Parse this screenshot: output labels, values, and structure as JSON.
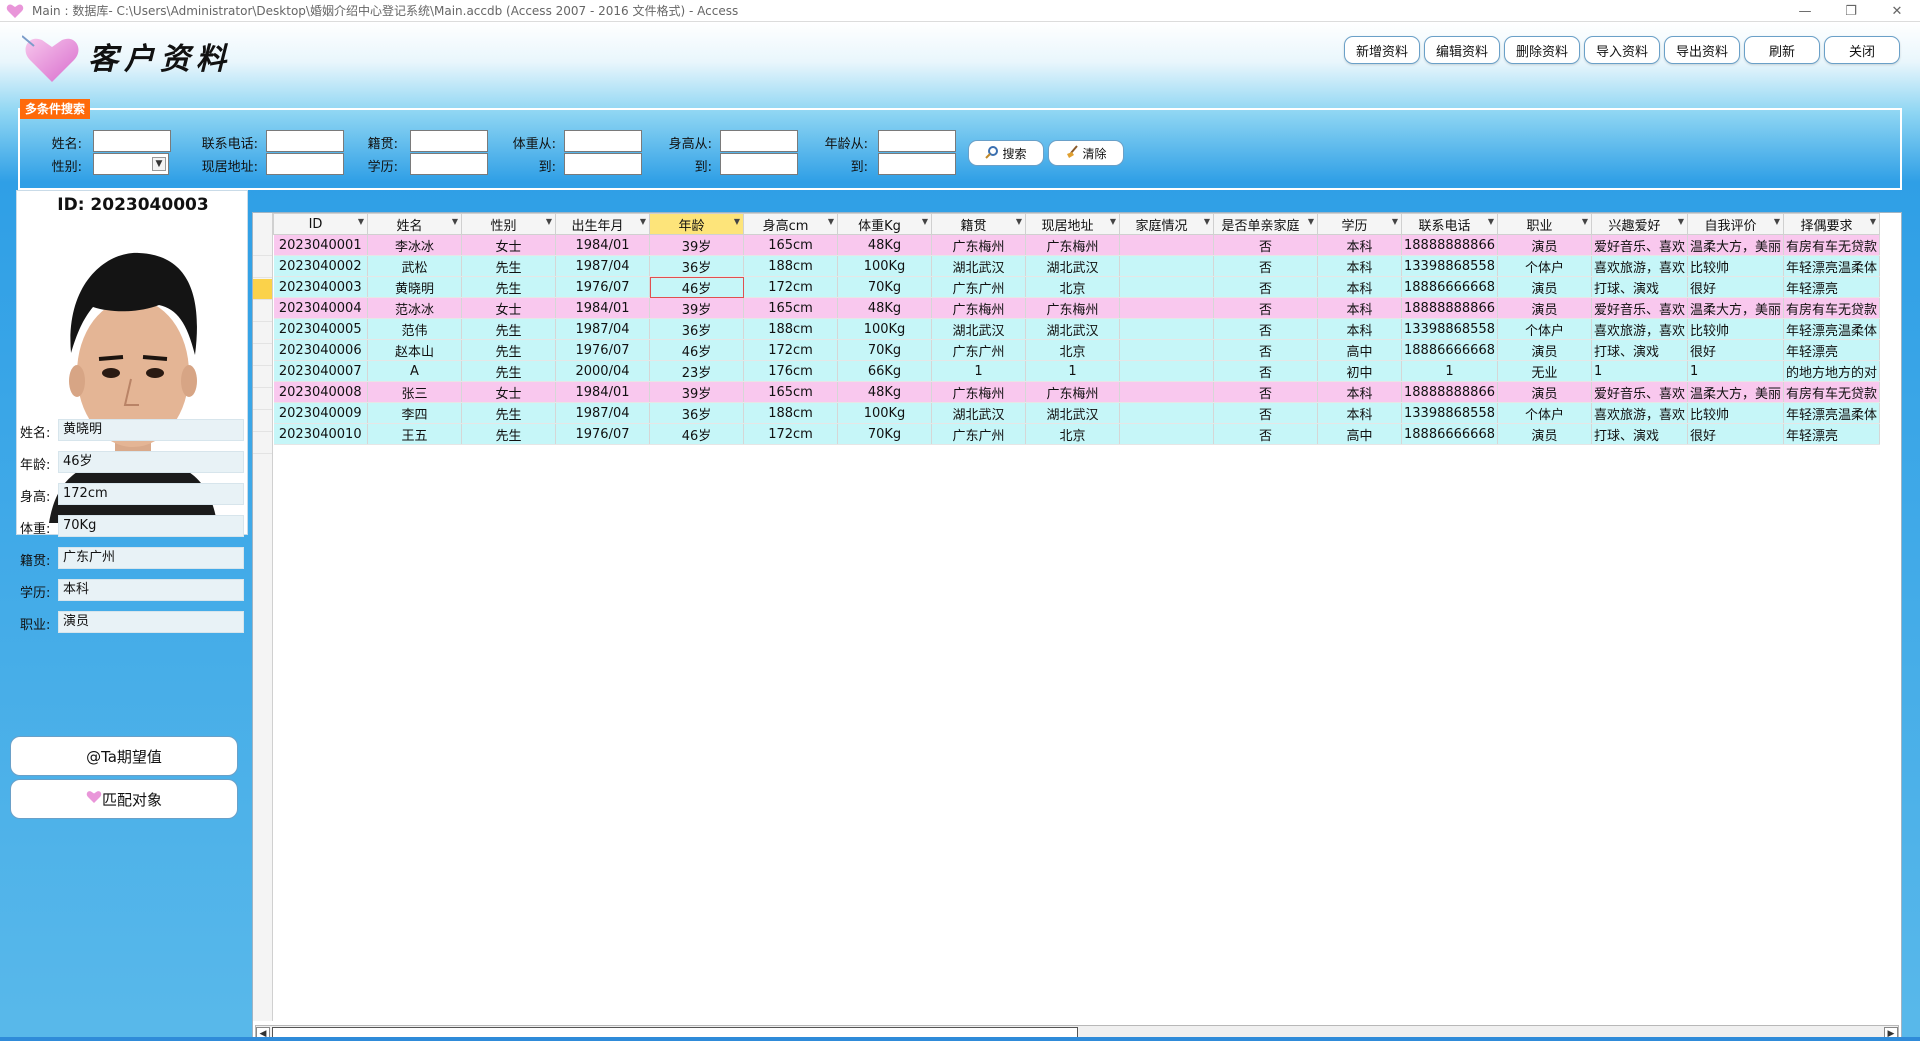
{
  "window": {
    "title": "Main : 数据库- C:\\Users\\Administrator\\Desktop\\婚姻介绍中心登记系统\\Main.accdb (Access 2007 - 2016 文件格式) - Access",
    "minimize": "—",
    "restore": "❐",
    "close": "✕"
  },
  "header": {
    "title": "客户资料"
  },
  "toolbar": {
    "add": "新增资料",
    "edit": "编辑资料",
    "delete": "删除资料",
    "import": "导入资料",
    "export": "导出资料",
    "refresh": "刷新",
    "close": "关闭"
  },
  "search": {
    "tag": "多条件搜索",
    "name_label": "姓名:",
    "gender_label": "性别:",
    "phone_label": "联系电话:",
    "address_label": "现居地址:",
    "native_label": "籍贯:",
    "education_label": "学历:",
    "weight_from_label": "体重从:",
    "weight_to_label": "到:",
    "height_from_label": "身高从:",
    "height_to_label": "到:",
    "age_from_label": "年龄从:",
    "age_to_label": "到:",
    "search_button": "搜索",
    "clear_button": "清除"
  },
  "detail": {
    "id_label": "ID:  2023040003",
    "fields": [
      {
        "label": "姓名:",
        "value": "黄晓明"
      },
      {
        "label": "年龄:",
        "value": "46岁"
      },
      {
        "label": "身高:",
        "value": "172cm"
      },
      {
        "label": "体重:",
        "value": "70Kg"
      },
      {
        "label": "籍贯:",
        "value": "广东广州"
      },
      {
        "label": "学历:",
        "value": "本科"
      },
      {
        "label": "职业:",
        "value": "演员"
      }
    ],
    "expect_button": "@Ta期望值",
    "match_button": "匹配对象"
  },
  "table": {
    "columns": [
      "ID",
      "姓名",
      "性别",
      "出生年月",
      "年龄",
      "身高cm",
      "体重Kg",
      "籍贯",
      "现居地址",
      "家庭情况",
      "是否单亲家庭",
      "学历",
      "联系电话",
      "职业",
      "兴趣爱好",
      "自我评价",
      "择偶要求"
    ],
    "rows": [
      [
        "2023040001",
        "李冰冰",
        "女士",
        "1984/01",
        "39岁",
        "165cm",
        "48Kg",
        "广东梅州",
        "广东梅州",
        "",
        "否",
        "本科",
        "18888888866",
        "演员",
        "爱好音乐、喜欢",
        "温柔大方，美丽",
        "有房有车无贷款"
      ],
      [
        "2023040002",
        "武松",
        "先生",
        "1987/04",
        "36岁",
        "188cm",
        "100Kg",
        "湖北武汉",
        "湖北武汉",
        "",
        "否",
        "本科",
        "13398868558",
        "个体户",
        "喜欢旅游，喜欢",
        "比较帅",
        "年轻漂亮温柔体"
      ],
      [
        "2023040003",
        "黄晓明",
        "先生",
        "1976/07",
        "46岁",
        "172cm",
        "70Kg",
        "广东广州",
        "北京",
        "",
        "否",
        "本科",
        "18886666668",
        "演员",
        "打球、演戏",
        "很好",
        "年轻漂亮"
      ],
      [
        "2023040004",
        "范冰冰",
        "女士",
        "1984/01",
        "39岁",
        "165cm",
        "48Kg",
        "广东梅州",
        "广东梅州",
        "",
        "否",
        "本科",
        "18888888866",
        "演员",
        "爱好音乐、喜欢",
        "温柔大方，美丽",
        "有房有车无贷款"
      ],
      [
        "2023040005",
        "范伟",
        "先生",
        "1987/04",
        "36岁",
        "188cm",
        "100Kg",
        "湖北武汉",
        "湖北武汉",
        "",
        "否",
        "本科",
        "13398868558",
        "个体户",
        "喜欢旅游，喜欢",
        "比较帅",
        "年轻漂亮温柔体"
      ],
      [
        "2023040006",
        "赵本山",
        "先生",
        "1976/07",
        "46岁",
        "172cm",
        "70Kg",
        "广东广州",
        "北京",
        "",
        "否",
        "高中",
        "18886666668",
        "演员",
        "打球、演戏",
        "很好",
        "年轻漂亮"
      ],
      [
        "2023040007",
        "A",
        "先生",
        "2000/04",
        "23岁",
        "176cm",
        "66Kg",
        "1",
        "1",
        "",
        "否",
        "初中",
        "1",
        "无业",
        "1",
        "1",
        "的地方地方的对"
      ],
      [
        "2023040008",
        "张三",
        "女士",
        "1984/01",
        "39岁",
        "165cm",
        "48Kg",
        "广东梅州",
        "广东梅州",
        "",
        "否",
        "本科",
        "18888888866",
        "演员",
        "爱好音乐、喜欢",
        "温柔大方，美丽",
        "有房有车无贷款"
      ],
      [
        "2023040009",
        "李四",
        "先生",
        "1987/04",
        "36岁",
        "188cm",
        "100Kg",
        "湖北武汉",
        "湖北武汉",
        "",
        "否",
        "本科",
        "13398868558",
        "个体户",
        "喜欢旅游，喜欢",
        "比较帅",
        "年轻漂亮温柔体"
      ],
      [
        "2023040010",
        "王五",
        "先生",
        "1976/07",
        "46岁",
        "172cm",
        "70Kg",
        "广东广州",
        "北京",
        "",
        "否",
        "高中",
        "18886666668",
        "演员",
        "打球、演戏",
        "很好",
        "年轻漂亮"
      ]
    ],
    "current_row": 2,
    "sorted_column": 4,
    "female_row_color": "#f9c8ee",
    "male_row_color": "#c6f6f8"
  },
  "colors": {
    "accent_orange": "#ff6a0a",
    "form_blue": "#2f9fe6",
    "selected_row_marker": "#fbd24a"
  },
  "icons": {
    "app": "heart-icon",
    "logo": "heart-logo",
    "search": "magnifier-icon",
    "clear": "broom-icon",
    "match": "heart-icon"
  }
}
